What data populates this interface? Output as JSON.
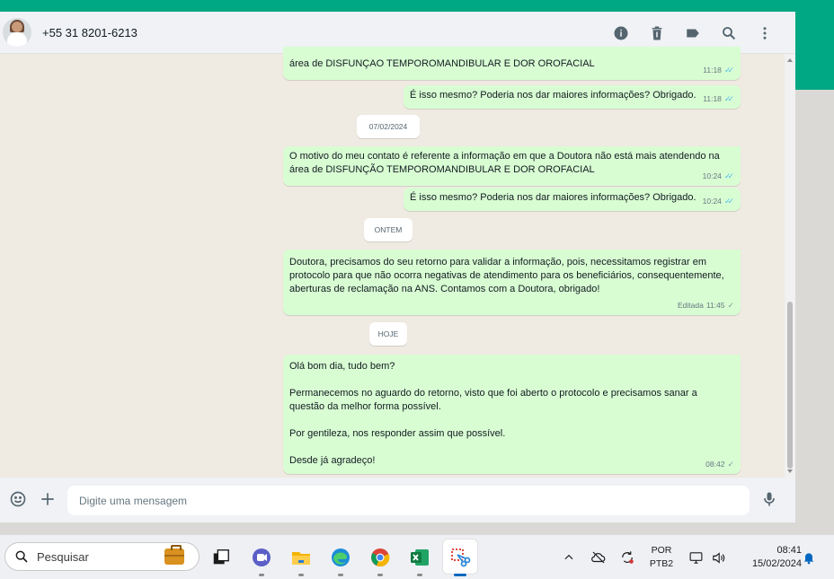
{
  "colors": {
    "accent": "#00a884",
    "outgoing_bubble": "#d9fdd3",
    "chat_background": "#efeae2",
    "read_check": "#53bdeb",
    "sent_check": "#8696a0"
  },
  "header": {
    "contact": "+55 31 8201-6213",
    "icons": [
      "info-icon",
      "trash-icon",
      "label-icon",
      "search-icon",
      "more-vertical-icon"
    ]
  },
  "messages": [
    {
      "text": "área de DISFUNÇAO TEMPOROMANDIBULAR E DOR OROFACIAL",
      "time": "11:18",
      "status": "read"
    },
    {
      "text": "É isso mesmo? Poderia nos dar maiores informações? Obrigado.",
      "time": "11:18",
      "status": "read"
    },
    {
      "text": "O motivo do meu contato é referente a informação em que a Doutora não está mais atendendo na área de DISFUNÇÃO TEMPOROMANDIBULAR E DOR OROFACIAL",
      "time": "10:24",
      "status": "read"
    },
    {
      "text": "É isso mesmo? Poderia nos dar maiores informações? Obrigado.",
      "time": "10:24",
      "status": "read"
    },
    {
      "text": "Doutora, precisamos do seu retorno para validar a informação, pois, necessitamos registrar em protocolo para que não ocorra negativas de atendimento para os beneficiários, consequentemente, aberturas de reclamação na ANS. Contamos com a Doutora, obrigado!",
      "time": "11:45",
      "edited_label": "Editada",
      "status": "sent"
    },
    {
      "text": "Olá bom dia, tudo bem?\n\nPermanecemos no aguardo do retorno, visto que foi aberto o protocolo e precisamos sanar a questão da melhor forma possível.\n\nPor gentileza, nos responder assim que possível.\n\nDesde já agradeço!",
      "time": "08:42",
      "status": "sent"
    }
  ],
  "date_separators": [
    "07/02/2024",
    "ONTEM",
    "HOJE"
  ],
  "composer": {
    "placeholder": "Digite uma mensagem",
    "icons": [
      "emoji-icon",
      "plus-icon",
      "microphone-icon"
    ]
  },
  "taskbar": {
    "search_placeholder": "Pesquisar",
    "apps": [
      "work-suitcase-icon",
      "task-view-icon",
      "teams-chat-icon",
      "file-explorer-icon",
      "edge-icon",
      "chrome-icon",
      "excel-icon",
      "snipping-tool-icon"
    ],
    "tray": {
      "language_line1": "POR",
      "language_line2": "PTB2",
      "time": "08:41",
      "date": "15/02/2024"
    }
  }
}
